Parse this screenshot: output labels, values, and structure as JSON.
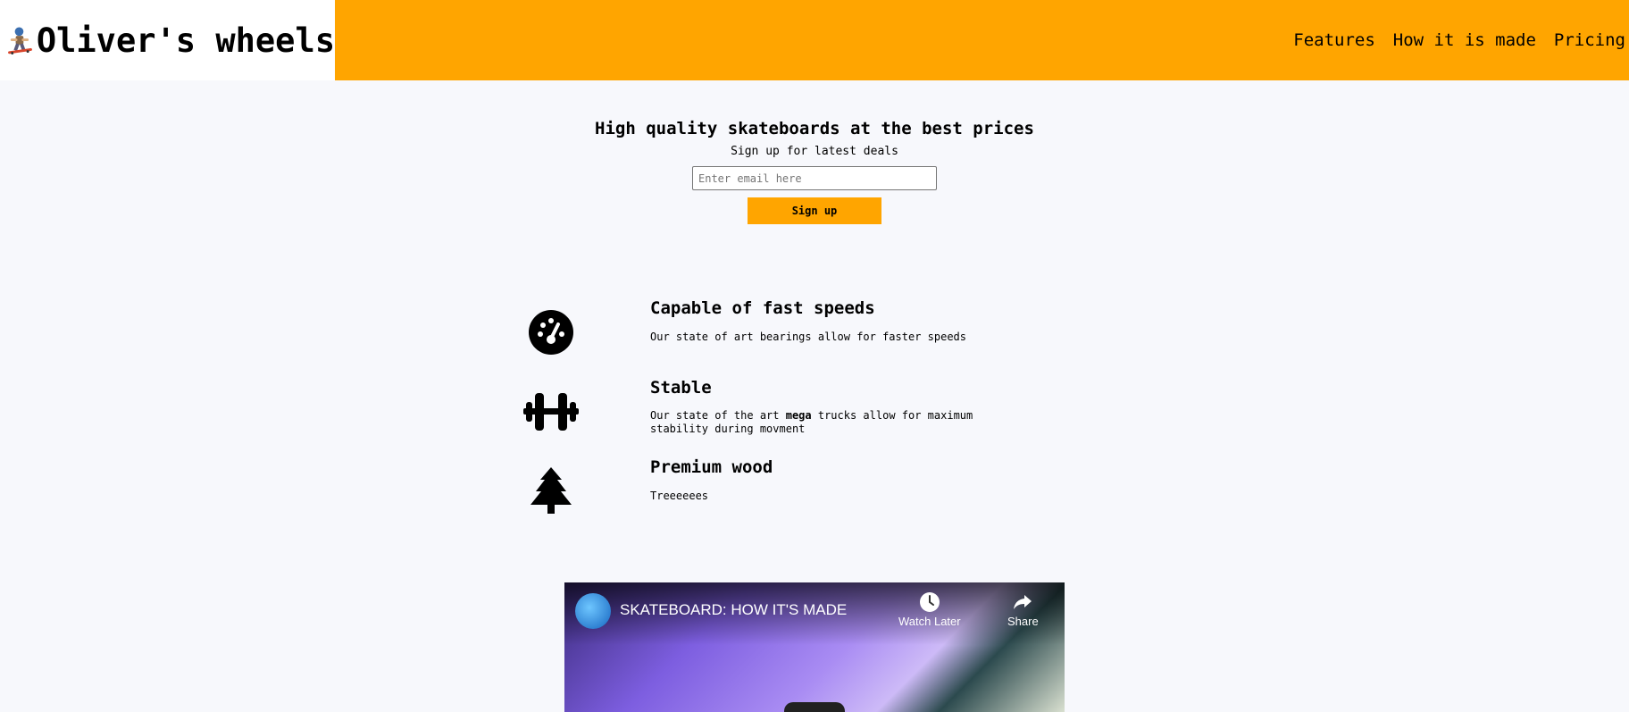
{
  "header": {
    "title": "Oliver's wheels",
    "logo_icon": "skateboarder-icon",
    "nav": [
      {
        "label": "Features"
      },
      {
        "label": "How it is made"
      },
      {
        "label": "Pricing"
      }
    ]
  },
  "hero": {
    "heading": "High quality skateboards at the best prices",
    "subheading": "Sign up for latest deals",
    "email_placeholder": "Enter email here",
    "signup_label": "Sign up"
  },
  "features": [
    {
      "icon": "speedometer-icon",
      "title": "Capable of fast speeds",
      "desc_before": "Our state of art bearings allow for faster speeds",
      "desc_bold": "",
      "desc_after": ""
    },
    {
      "icon": "dumbbell-icon",
      "title": "Stable",
      "desc_before": "Our state of the art ",
      "desc_bold": "mega",
      "desc_after": " trucks allow for maximum stability during movment"
    },
    {
      "icon": "tree-icon",
      "title": "Premium wood",
      "desc_before": "Treeeeees",
      "desc_bold": "",
      "desc_after": ""
    }
  ],
  "video": {
    "title": "SKATEBOARD: HOW IT'S MADE",
    "watch_later": "Watch Later",
    "share": "Share"
  },
  "colors": {
    "accent": "#ffa500",
    "background": "#f7f8fc"
  }
}
